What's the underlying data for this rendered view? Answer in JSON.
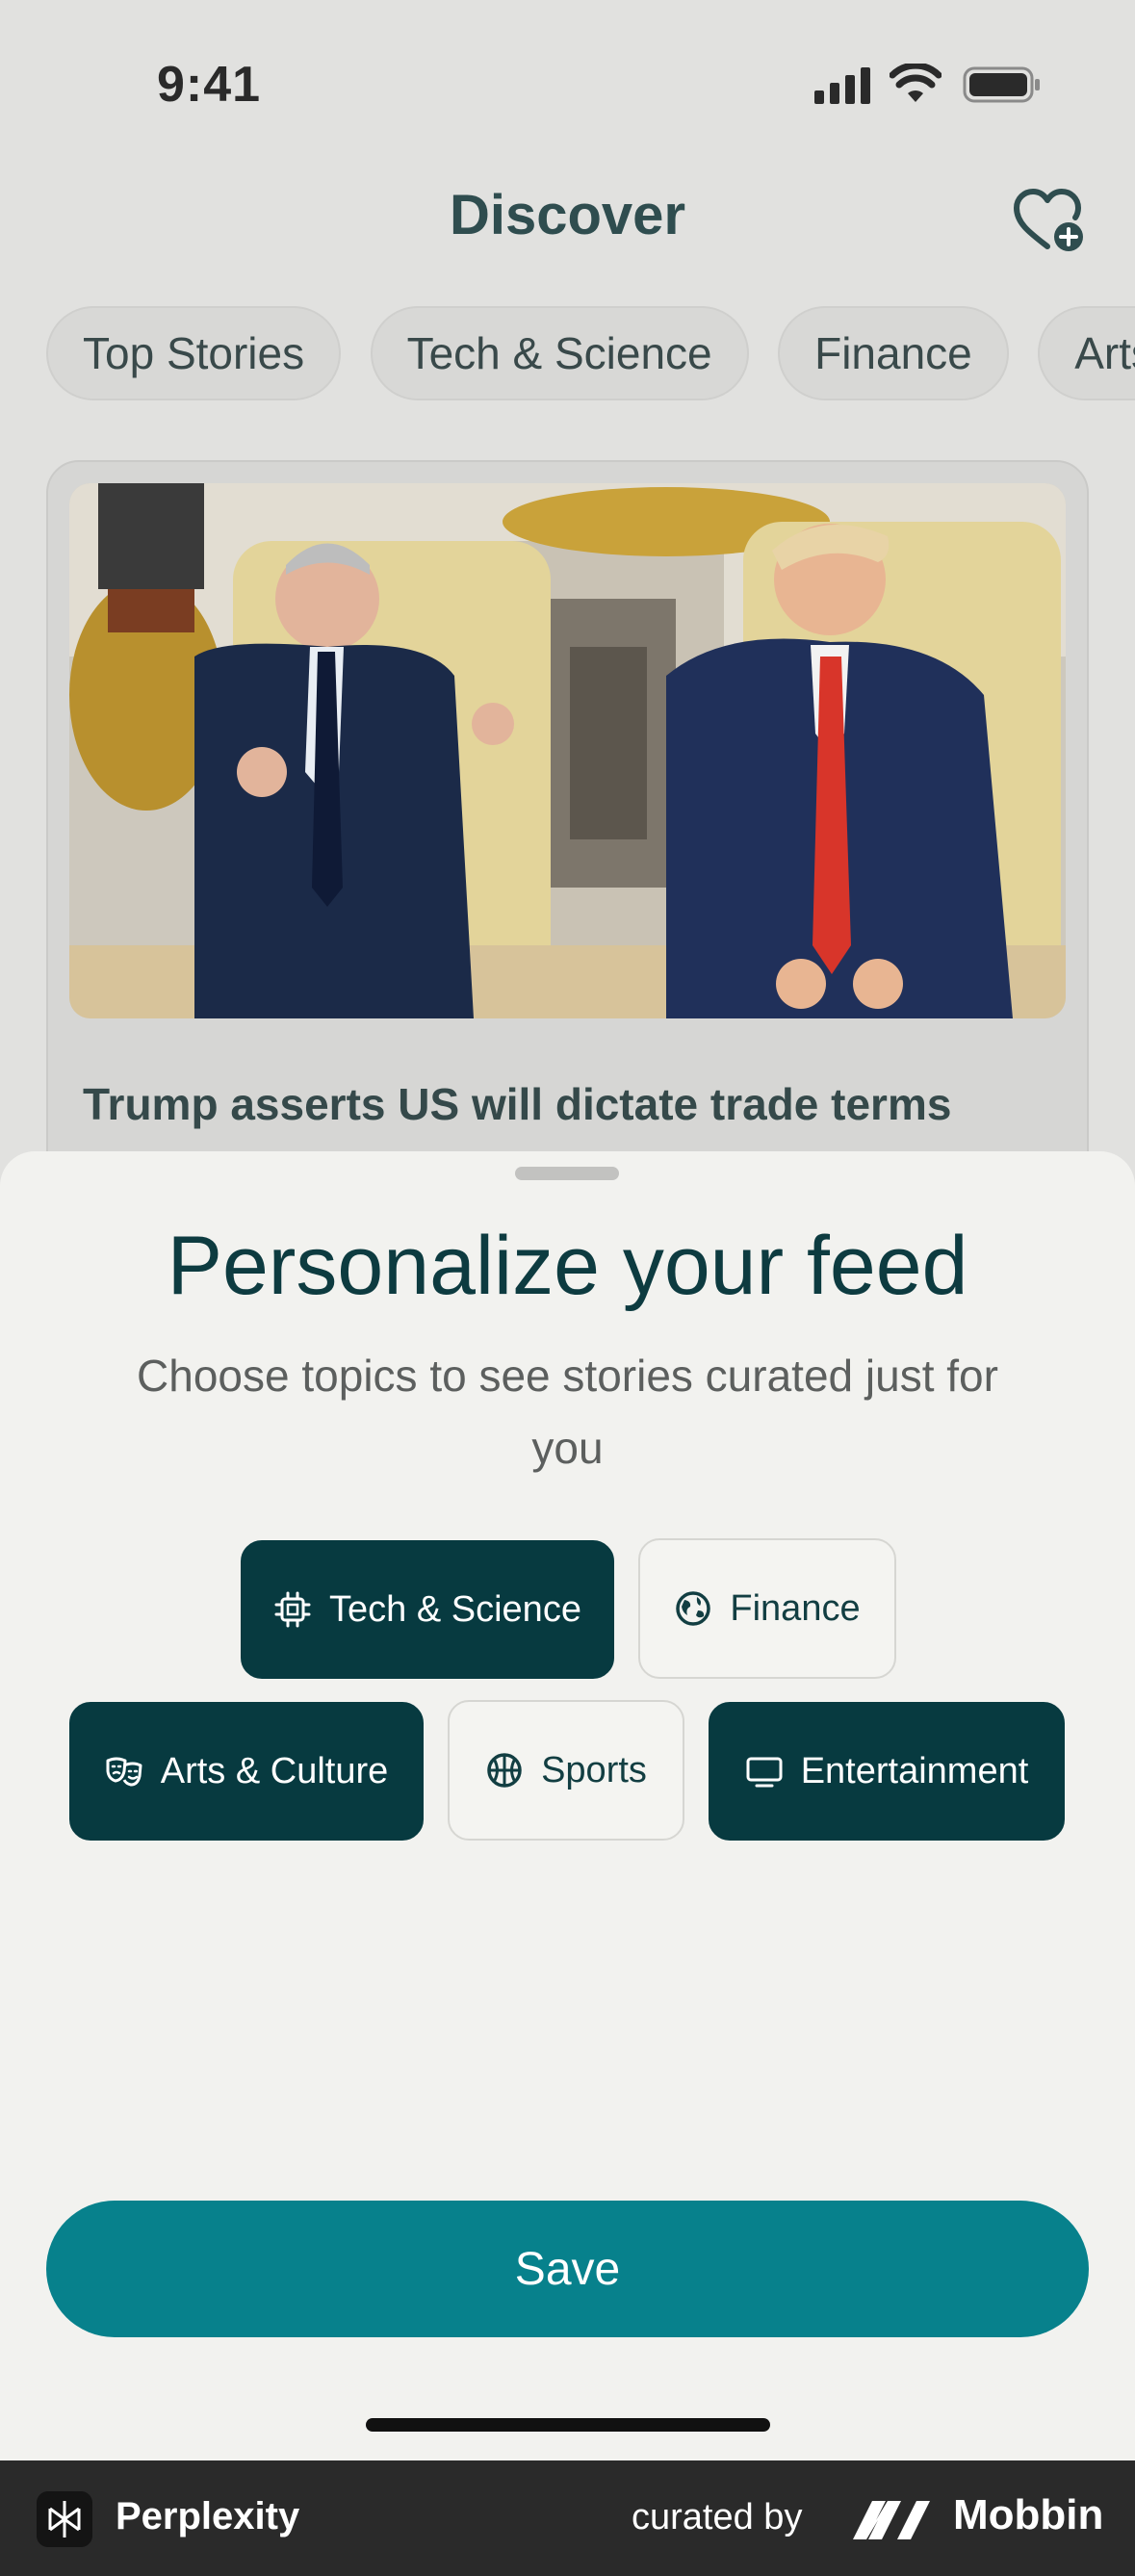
{
  "status_bar": {
    "time": "9:41"
  },
  "header": {
    "title": "Discover"
  },
  "categories": [
    "Top Stories",
    "Tech & Science",
    "Finance",
    "Arts & Culture"
  ],
  "news_card": {
    "headline": "Trump asserts US will dictate trade terms"
  },
  "sheet": {
    "title": "Personalize your feed",
    "subtitle": "Choose topics to see stories curated just for you",
    "topics": [
      {
        "label": "Tech & Science",
        "selected": true,
        "icon": "chip-icon"
      },
      {
        "label": "Finance",
        "selected": false,
        "icon": "globe-icon"
      },
      {
        "label": "Arts & Culture",
        "selected": true,
        "icon": "theater-masks-icon"
      },
      {
        "label": "Sports",
        "selected": false,
        "icon": "basketball-icon"
      },
      {
        "label": "Entertainment",
        "selected": true,
        "icon": "monitor-icon"
      }
    ],
    "save_label": "Save"
  },
  "footer": {
    "brand": "Perplexity",
    "curated_by": "curated by",
    "mobbin": "Mobbin"
  },
  "colors": {
    "accent": "#07818c",
    "selected_topic": "#073a40",
    "title": "#0d3b40"
  }
}
